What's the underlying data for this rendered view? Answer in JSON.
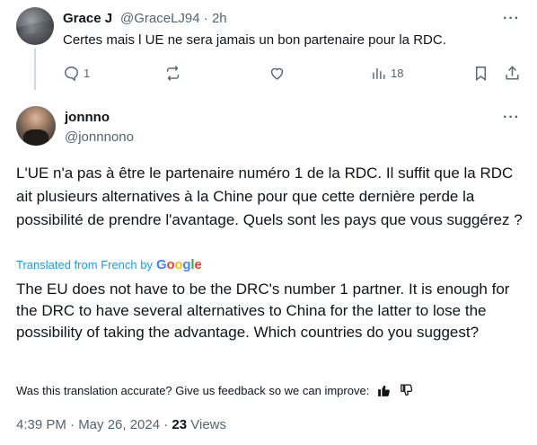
{
  "reply": {
    "name": "Grace J",
    "handle": "@GraceLJ94",
    "time": "· 2h",
    "text": "Certes mais l UE ne sera jamais un bon partenaire pour la RDC.",
    "replies": "1",
    "views": "18"
  },
  "tweet": {
    "name": "jonnno",
    "handle": "@jonnnono",
    "text": "L'UE n'a pas à être le partenaire numéro 1 de la RDC. Il suffit que la RDC ait plusieurs alternatives à la Chine pour que cette dernière perde la possibilité de prendre l'avantage. Quels sont les pays que vous suggérez ?",
    "translated_label": "Translated from French by",
    "google": [
      "G",
      "o",
      "o",
      "g",
      "l",
      "e"
    ],
    "translation": "The EU does not have to be the DRC's number 1 partner. It is enough for the DRC to have several alternatives to China for the latter to lose the possibility of taking the advantage. Which countries do you suggest?",
    "feedback": "Was this translation accurate? Give us feedback so we can improve:",
    "timestamp": "4:39 PM · May 26, 2024 · ",
    "views_count": "23",
    "views_label": " Views"
  },
  "icons": {
    "more": "···"
  }
}
